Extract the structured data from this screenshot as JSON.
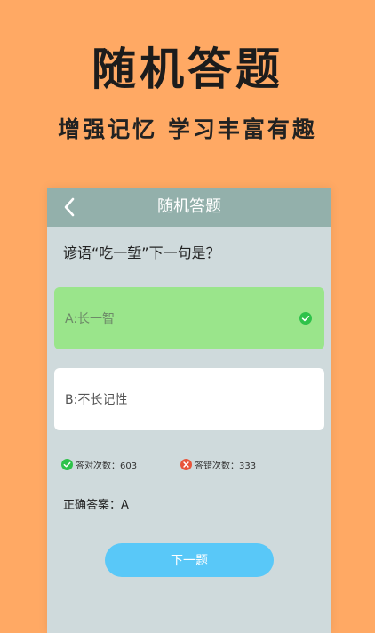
{
  "banner": {
    "title": "随机答题",
    "subtitle": "增强记忆 学习丰富有趣"
  },
  "app": {
    "back_icon": "chevron-left-icon",
    "header_title": "随机答题",
    "question": "谚语“吃一堑”下一句是？",
    "options": [
      {
        "label": "A:长一智",
        "state": "correct-selected",
        "icon": "check-circle-icon"
      },
      {
        "label": "B:不长记性",
        "state": "default"
      }
    ],
    "stats": {
      "correct": "答对次数：603",
      "wrong": "答错次数：333"
    },
    "answer": "正确答案：A",
    "next_button": "下一题"
  },
  "colors": {
    "background": "#ffa964",
    "screen_bg": "#cfdadc",
    "header_bg": "#93b0ab",
    "correct_option_bg": "#9ae58b",
    "correct_icon": "#2ec24a",
    "wrong_icon": "#e8553b",
    "next_button_bg": "#59c8f8"
  }
}
